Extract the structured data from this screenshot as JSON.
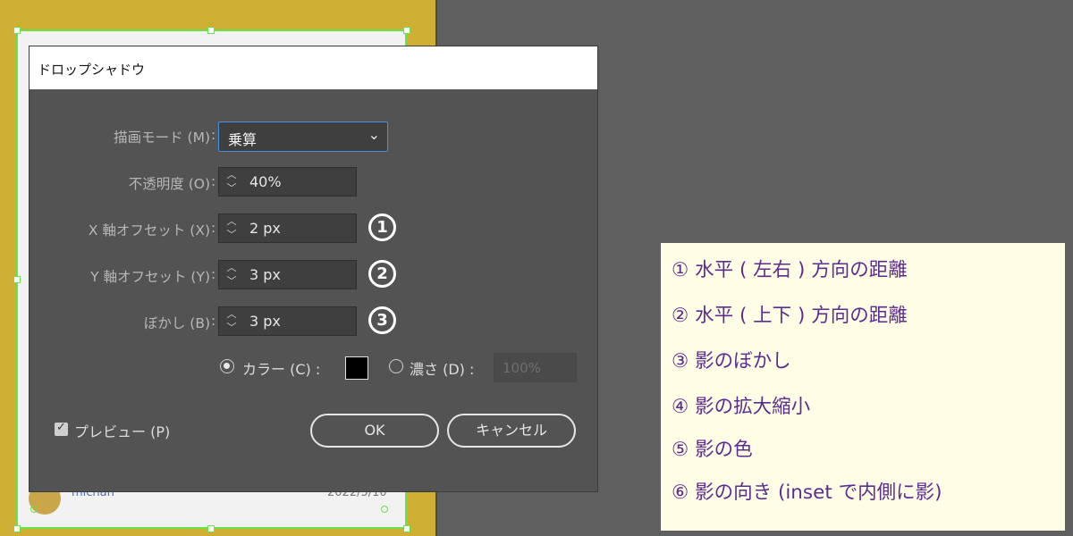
{
  "dialog": {
    "title": "ドロップシャドウ",
    "mode": {
      "label": "描画モード (M)",
      "value": "乗算"
    },
    "opacity": {
      "label": "不透明度 (O)",
      "value": "40%"
    },
    "x_offset": {
      "label": "X 軸オフセット (X)",
      "value": "2 px",
      "marker": "1"
    },
    "y_offset": {
      "label": "Y 軸オフセット (Y)",
      "value": "3 px",
      "marker": "2"
    },
    "blur": {
      "label": "ぼかし (B)",
      "value": "3 px",
      "marker": "3"
    },
    "color_option": {
      "label": "カラー (C) :",
      "selected": true,
      "swatch": "#000000"
    },
    "darkness_option": {
      "label": "濃さ (D) :",
      "selected": false,
      "value": "100%"
    },
    "colon": ":",
    "preview": {
      "label": "プレビュー (P)",
      "checked": true
    },
    "ok_label": "OK",
    "cancel_label": "キャンセル"
  },
  "background_card": {
    "name": "michan",
    "date": "2022/5/10"
  },
  "legend": [
    "① 水平 ( 左右 ) 方向の距離",
    "②  水平 ( 上下 ) 方向の距離",
    "③ 影のぼかし",
    "④ 影の拡大縮小",
    "⑤ 影の色",
    "⑥ 影の向き (inset で内側に影)"
  ],
  "colors": {
    "left_panel": "#cfaf32",
    "dark_bg": "#5f5f5f",
    "dialog_bg": "#535353",
    "selection": "#6ae24a",
    "legend_bg": "#fffde6",
    "legend_text": "#5b2d8e"
  }
}
